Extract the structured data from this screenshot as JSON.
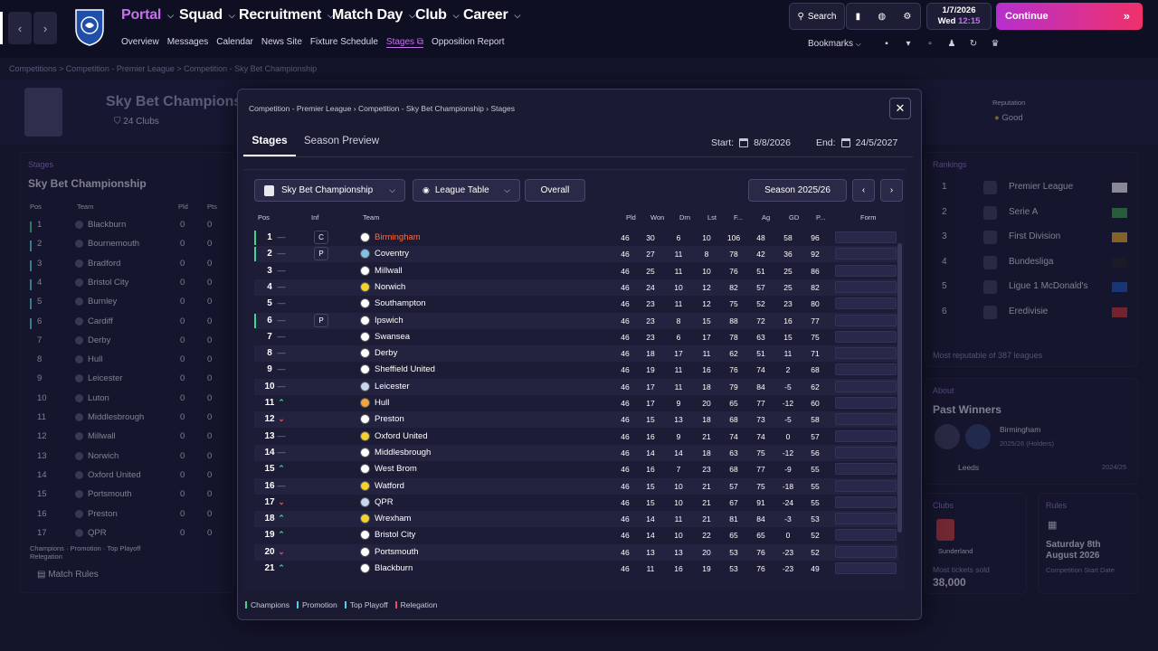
{
  "topbar": {
    "menus": [
      "Portal",
      "Squad",
      "Recruitment",
      "Match Day",
      "Club",
      "Career"
    ],
    "subnav": [
      "Overview",
      "Messages",
      "Calendar",
      "News Site",
      "Fixture Schedule",
      "Stages",
      "Opposition Report"
    ],
    "subnav_active": "Stages",
    "search_label": "Search",
    "date": "1/7/2026",
    "day": "Wed",
    "time": "12:15",
    "continue_label": "Continue",
    "bookmarks_label": "Bookmarks"
  },
  "page_breadcrumb": [
    "Competitions",
    "Competition - Premier League",
    "Competition - Sky Bet Championship"
  ],
  "background": {
    "competition_title": "Sky Bet Champions",
    "clubs_count": "24 Clubs",
    "reputation_label": "Reputation",
    "reputation_value": "Good",
    "stages_label": "Stages",
    "stages_title": "Sky Bet Championship",
    "left_cols": [
      "Pos",
      "Team",
      "Pld",
      "Pts"
    ],
    "left_teams": [
      "Blackburn",
      "Bournemouth",
      "Bradford",
      "Bristol City",
      "Burnley",
      "Cardiff",
      "Derby",
      "Hull",
      "Leicester",
      "Luton",
      "Middlesbrough",
      "Millwall",
      "Norwich",
      "Oxford United",
      "Portsmouth",
      "Preston",
      "QPR"
    ],
    "left_legend": [
      "Champions",
      "Promotion",
      "Top Playoff",
      "Relegation"
    ],
    "match_rules": "Match Rules",
    "rankings_label": "Rankings",
    "rankings": [
      {
        "pos": "1",
        "name": "Premier League"
      },
      {
        "pos": "2",
        "name": "Serie A"
      },
      {
        "pos": "3",
        "name": "First Division"
      },
      {
        "pos": "4",
        "name": "Bundesliga"
      },
      {
        "pos": "5",
        "name": "Ligue 1 McDonald's"
      },
      {
        "pos": "6",
        "name": "Eredivisie"
      }
    ],
    "rankings_footer": "Most reputable of 387 leagues",
    "about_label": "About",
    "past_winners_title": "Past Winners",
    "past_winner_name": "Birmingham",
    "past_winner_season": "2025/26 (Holders)",
    "past_winner_2": "Leeds",
    "past_winner_2_season": "2024/25",
    "clubs_label": "Clubs",
    "clubs_team": "Sunderland",
    "clubs_stat_label": "Most tickets sold",
    "clubs_stat_value": "38,000",
    "rules_label": "Rules",
    "rules_date": "Saturday 8th August 2026",
    "rules_sub": "Competition Start Date"
  },
  "modal": {
    "breadcrumb": [
      "Competition - Premier League",
      "Competition - Sky Bet Championship",
      "Stages"
    ],
    "tabs": [
      "Stages",
      "Season Preview"
    ],
    "start_label": "Start:",
    "start_date": "8/8/2026",
    "end_label": "End:",
    "end_date": "24/5/2027",
    "competition_select": "Sky Bet Championship",
    "view_select": "League Table",
    "overall_label": "Overall",
    "season_label": "Season 2025/26",
    "columns": [
      "Pos",
      "Inf",
      "Team",
      "Pld",
      "Won",
      "Drn",
      "Lst",
      "F...",
      "Ag",
      "GD",
      "P...",
      "Form"
    ],
    "rows": [
      {
        "pos": "1",
        "trend": "—",
        "inf": "C",
        "team": "Birmingham",
        "pld": "46",
        "won": "30",
        "drn": "6",
        "lst": "10",
        "f": "106",
        "ag": "48",
        "gd": "58",
        "pts": "96",
        "marker": "#3dd68c",
        "highlight": true,
        "badge": "#ffffff"
      },
      {
        "pos": "2",
        "trend": "—",
        "inf": "P",
        "team": "Coventry",
        "pld": "46",
        "won": "27",
        "drn": "11",
        "lst": "8",
        "f": "78",
        "ag": "42",
        "gd": "36",
        "pts": "92",
        "marker": "#3dd68c",
        "badge": "#7fc4e8"
      },
      {
        "pos": "3",
        "trend": "—",
        "inf": "",
        "team": "Millwall",
        "pld": "46",
        "won": "25",
        "drn": "11",
        "lst": "10",
        "f": "76",
        "ag": "51",
        "gd": "25",
        "pts": "86",
        "marker": "",
        "badge": "#ffffff"
      },
      {
        "pos": "4",
        "trend": "—",
        "inf": "",
        "team": "Norwich",
        "pld": "46",
        "won": "24",
        "drn": "10",
        "lst": "12",
        "f": "82",
        "ag": "57",
        "gd": "25",
        "pts": "82",
        "marker": "",
        "badge": "#f4d22e"
      },
      {
        "pos": "5",
        "trend": "—",
        "inf": "",
        "team": "Southampton",
        "pld": "46",
        "won": "23",
        "drn": "11",
        "lst": "12",
        "f": "75",
        "ag": "52",
        "gd": "23",
        "pts": "80",
        "marker": "",
        "badge": "#ffffff"
      },
      {
        "pos": "6",
        "trend": "—",
        "inf": "P",
        "team": "Ipswich",
        "pld": "46",
        "won": "23",
        "drn": "8",
        "lst": "15",
        "f": "88",
        "ag": "72",
        "gd": "16",
        "pts": "77",
        "marker": "#3dd68c",
        "badge": "#ffffff"
      },
      {
        "pos": "7",
        "trend": "—",
        "inf": "",
        "team": "Swansea",
        "pld": "46",
        "won": "23",
        "drn": "6",
        "lst": "17",
        "f": "78",
        "ag": "63",
        "gd": "15",
        "pts": "75",
        "marker": "",
        "badge": "#ffffff"
      },
      {
        "pos": "8",
        "trend": "—",
        "inf": "",
        "team": "Derby",
        "pld": "46",
        "won": "18",
        "drn": "17",
        "lst": "11",
        "f": "62",
        "ag": "51",
        "gd": "11",
        "pts": "71",
        "marker": "",
        "badge": "#ffffff"
      },
      {
        "pos": "9",
        "trend": "—",
        "inf": "",
        "team": "Sheffield United",
        "pld": "46",
        "won": "19",
        "drn": "11",
        "lst": "16",
        "f": "76",
        "ag": "74",
        "gd": "2",
        "pts": "68",
        "marker": "",
        "badge": "#ffffff"
      },
      {
        "pos": "10",
        "trend": "—",
        "inf": "",
        "team": "Leicester",
        "pld": "46",
        "won": "17",
        "drn": "11",
        "lst": "18",
        "f": "79",
        "ag": "84",
        "gd": "-5",
        "pts": "62",
        "marker": "",
        "badge": "#c8d4f0"
      },
      {
        "pos": "11",
        "trend": "up",
        "inf": "",
        "team": "Hull",
        "pld": "46",
        "won": "17",
        "drn": "9",
        "lst": "20",
        "f": "65",
        "ag": "77",
        "gd": "-12",
        "pts": "60",
        "marker": "",
        "badge": "#f2a53a"
      },
      {
        "pos": "12",
        "trend": "down",
        "inf": "",
        "team": "Preston",
        "pld": "46",
        "won": "15",
        "drn": "13",
        "lst": "18",
        "f": "68",
        "ag": "73",
        "gd": "-5",
        "pts": "58",
        "marker": "",
        "badge": "#ffffff"
      },
      {
        "pos": "13",
        "trend": "—",
        "inf": "",
        "team": "Oxford United",
        "pld": "46",
        "won": "16",
        "drn": "9",
        "lst": "21",
        "f": "74",
        "ag": "74",
        "gd": "0",
        "pts": "57",
        "marker": "",
        "badge": "#f4d22e"
      },
      {
        "pos": "14",
        "trend": "—",
        "inf": "",
        "team": "Middlesbrough",
        "pld": "46",
        "won": "14",
        "drn": "14",
        "lst": "18",
        "f": "63",
        "ag": "75",
        "gd": "-12",
        "pts": "56",
        "marker": "",
        "badge": "#ffffff"
      },
      {
        "pos": "15",
        "trend": "up",
        "inf": "",
        "team": "West Brom",
        "pld": "46",
        "won": "16",
        "drn": "7",
        "lst": "23",
        "f": "68",
        "ag": "77",
        "gd": "-9",
        "pts": "55",
        "marker": "",
        "badge": "#ffffff"
      },
      {
        "pos": "16",
        "trend": "—",
        "inf": "",
        "team": "Watford",
        "pld": "46",
        "won": "15",
        "drn": "10",
        "lst": "21",
        "f": "57",
        "ag": "75",
        "gd": "-18",
        "pts": "55",
        "marker": "",
        "badge": "#f4d22e"
      },
      {
        "pos": "17",
        "trend": "down",
        "inf": "",
        "team": "QPR",
        "pld": "46",
        "won": "15",
        "drn": "10",
        "lst": "21",
        "f": "67",
        "ag": "91",
        "gd": "-24",
        "pts": "55",
        "marker": "",
        "badge": "#c8d4f0"
      },
      {
        "pos": "18",
        "trend": "up",
        "inf": "",
        "team": "Wrexham",
        "pld": "46",
        "won": "14",
        "drn": "11",
        "lst": "21",
        "f": "81",
        "ag": "84",
        "gd": "-3",
        "pts": "53",
        "marker": "",
        "badge": "#f4d22e"
      },
      {
        "pos": "19",
        "trend": "up",
        "inf": "",
        "team": "Bristol City",
        "pld": "46",
        "won": "14",
        "drn": "10",
        "lst": "22",
        "f": "65",
        "ag": "65",
        "gd": "0",
        "pts": "52",
        "marker": "",
        "badge": "#ffffff"
      },
      {
        "pos": "20",
        "trend": "down",
        "inf": "",
        "team": "Portsmouth",
        "pld": "46",
        "won": "13",
        "drn": "13",
        "lst": "20",
        "f": "53",
        "ag": "76",
        "gd": "-23",
        "pts": "52",
        "marker": "",
        "badge": "#ffffff"
      },
      {
        "pos": "21",
        "trend": "up",
        "inf": "",
        "team": "Blackburn",
        "pld": "46",
        "won": "11",
        "drn": "16",
        "lst": "19",
        "f": "53",
        "ag": "76",
        "gd": "-23",
        "pts": "49",
        "marker": "",
        "badge": "#ffffff"
      }
    ],
    "legend": [
      {
        "label": "Champions",
        "color": "#3dd68c"
      },
      {
        "label": "Promotion",
        "color": "#4fd1e0"
      },
      {
        "label": "Top Playoff",
        "color": "#4fd1e0"
      },
      {
        "label": "Relegation",
        "color": "#e04f5f"
      }
    ]
  },
  "colors": {
    "accent": "#c86ff0",
    "highlight_team": "#ff6b3d",
    "up": "#3dd68c",
    "down": "#e04f5f"
  }
}
